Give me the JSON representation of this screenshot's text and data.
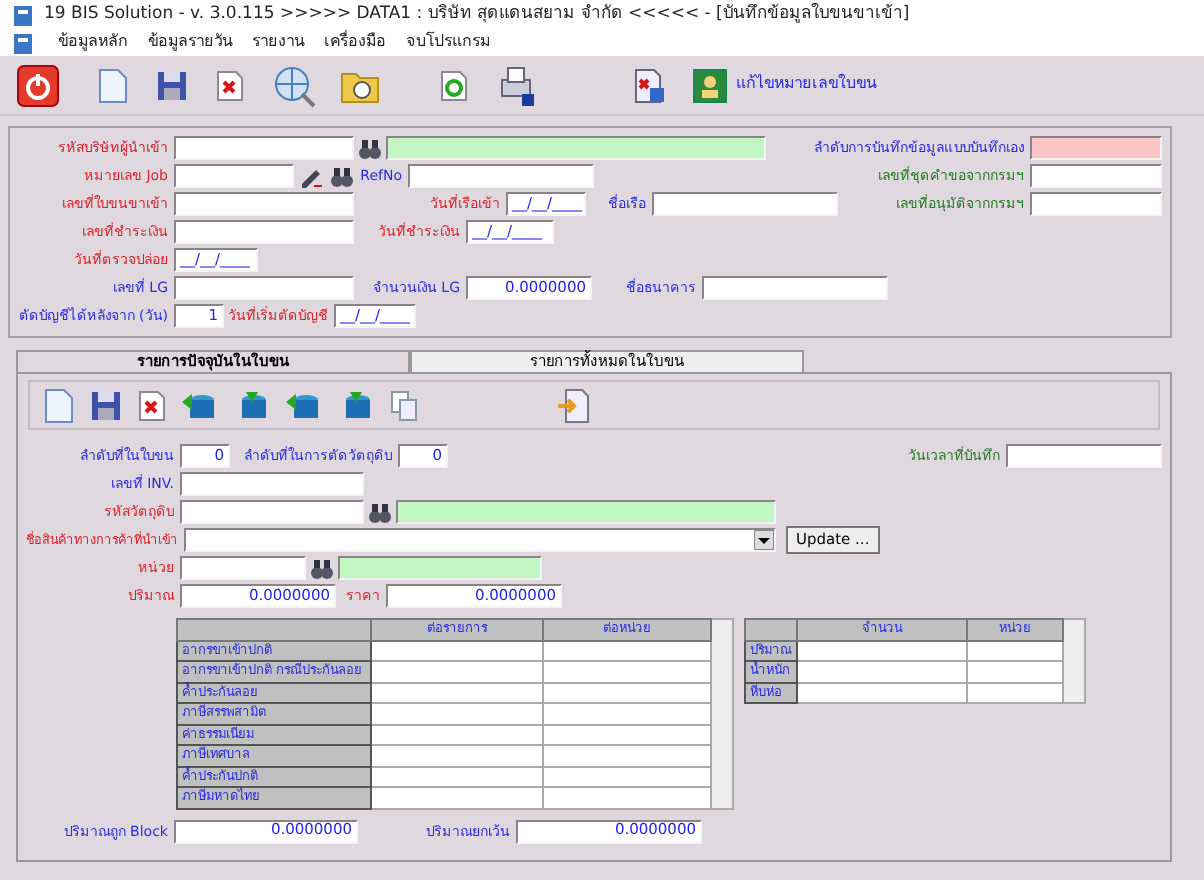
{
  "window": {
    "title": "19 BIS Solution - v. 3.0.115 >>>>> DATA1 : บริษัท สุดแดนสยาม จำกัด <<<<< - [บันทึกข้อมูลใบขนขาเข้า]"
  },
  "menu": [
    "ข้อมูลหลัก",
    "ข้อมูลรายวัน",
    "รายงาน",
    "เครื่องมือ",
    "จบโปรแกรม"
  ],
  "toolbar": {
    "edit_button": "แก้ไขหมายเลขใบขน"
  },
  "header": {
    "rows": [
      [
        {
          "label": "รหัสบริษัทผู้นำเข้า",
          "color": "#e0202a",
          "kind": "lookup"
        }
      ],
      [
        {
          "label": "หมายเลข Job",
          "color": "#e0202a",
          "kind": "job"
        },
        {
          "label": "RefNo",
          "color": "#2a2ae6",
          "kind": "text"
        }
      ],
      [
        {
          "label": "เลขที่ใบขนขาเข้า",
          "color": "#e0202a",
          "kind": "text"
        },
        {
          "label": "วันที่เรือเข้า",
          "color": "#e0202a",
          "kind": "date",
          "value": "__/__/____"
        },
        {
          "label": "ชื่อเรือ",
          "color": "#2a2ae6",
          "kind": "text"
        }
      ],
      [
        {
          "label": "เลขที่ชำระเงิน",
          "color": "#e0202a",
          "kind": "text"
        },
        {
          "label": "วันที่ชำระเงิน",
          "color": "#e0202a",
          "kind": "date",
          "value": "__/__/____"
        }
      ],
      [
        {
          "label": "วันที่ตรวจปล่อย",
          "color": "#e0202a",
          "kind": "date",
          "value": "__/__/____"
        }
      ],
      [
        {
          "label": "เลขที่ LG",
          "color": "#2a2ae6",
          "kind": "text"
        },
        {
          "label": "จำนวนเงิน LG",
          "color": "#2a2ae6",
          "kind": "number",
          "value": "0.0000000"
        },
        {
          "label": "ชื่อธนาคาร",
          "color": "#2a2ae6",
          "kind": "text"
        }
      ],
      [
        {
          "label": "ตัดบัญชีได้หลังจาก (วัน)",
          "color": "#2a2ae6",
          "kind": "number",
          "value": "1"
        },
        {
          "label": "วันที่เริ่มตัดบัญชี",
          "color": "#e0202a",
          "kind": "date",
          "value": "__/__/____"
        }
      ]
    ],
    "side": [
      {
        "label": "ลำดับการบันทึกข้อมูลแบบบันทึกเอง",
        "color": "#2a2ae6",
        "kind": "highlight"
      },
      {
        "label": "เลขที่ชุดคำขอจากกรมฯ",
        "color": "#1f7a1f",
        "kind": "text"
      },
      {
        "label": "เลขที่อนุมัติจากกรมฯ",
        "color": "#1f7a1f",
        "kind": "text"
      }
    ]
  },
  "tabs": [
    {
      "label": "รายการปัจจุบันในใบขน",
      "selected": true
    },
    {
      "label": "รายการทั้งหมดในใบขน",
      "selected": false
    }
  ],
  "item_form": {
    "rows": [
      [
        {
          "label": "ลำดับที่ในใบขน",
          "color": "#2a2ae6",
          "kind": "number",
          "value": "0"
        },
        {
          "label": "ลำดับที่ในการตัดวัตถุดิบ",
          "color": "#2a2ae6",
          "kind": "number",
          "value": "0"
        },
        {
          "label": "วันเวลาที่บันทึก",
          "color": "#1f7a1f",
          "kind": "text"
        }
      ],
      [
        {
          "label": "เลขที่ INV.",
          "color": "#2a2ae6",
          "kind": "text"
        }
      ],
      [
        {
          "label": "รหัสวัตถุดิบ",
          "color": "#e0202a",
          "kind": "lookup"
        }
      ],
      [
        {
          "label": "ชื่อสินค้าทางการค้าที่นำเข้า",
          "color": "#e0202a",
          "kind": "select",
          "button": "Update ..."
        }
      ],
      [
        {
          "label": "หน่วย",
          "color": "#e0202a",
          "kind": "lookup"
        }
      ],
      [
        {
          "label": "ปริมาณ",
          "color": "#e0202a",
          "kind": "number",
          "value": "0.0000000"
        },
        {
          "label": "ราคา",
          "color": "#e0202a",
          "kind": "number",
          "value": "0.0000000"
        }
      ]
    ],
    "tax_table": {
      "columns": [
        "ต่อรายการ",
        "ต่อหน่วย"
      ],
      "rows": [
        "อากรขาเข้าปกติ",
        "อากรขาเข้าปกติ กรณีประกันลอย",
        "ค้ำประกันลอย",
        "ภาษีสรรพสามิต",
        "ค่าธรรมเนียม",
        "ภาษีเทศบาล",
        "ค้ำประกันปกติ",
        "ภาษีมหาดไทย"
      ]
    },
    "quantity_table": {
      "columns": [
        "จำนวน",
        "หน่วย"
      ],
      "rows": [
        "ปริมาณ",
        "น้ำหนัก",
        "หีบห่อ"
      ]
    },
    "bottom": [
      {
        "label": "ปริมาณถูก Block",
        "color": "#2a2ae6",
        "kind": "number",
        "value": "0.0000000"
      },
      {
        "label": "ปริมาณยกเว้น",
        "color": "#2a2ae6",
        "kind": "number",
        "value": "0.0000000"
      }
    ]
  }
}
